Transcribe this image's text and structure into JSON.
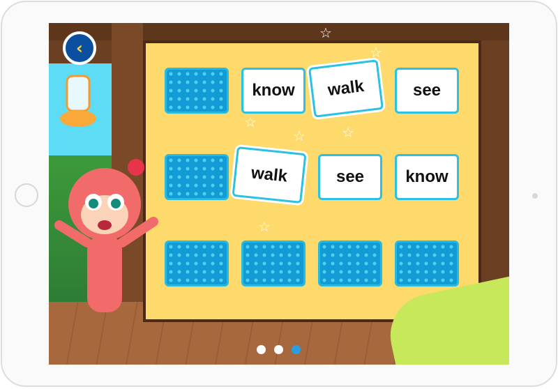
{
  "game": {
    "back_icon": "chevron-left-icon",
    "cards": [
      [
        {
          "state": "back",
          "word": ""
        },
        {
          "state": "face",
          "word": "know"
        },
        {
          "state": "face",
          "word": "walk",
          "highlight": true
        },
        {
          "state": "face",
          "word": "see"
        }
      ],
      [
        {
          "state": "back",
          "word": ""
        },
        {
          "state": "face",
          "word": "walk",
          "highlight": true
        },
        {
          "state": "face",
          "word": "see"
        },
        {
          "state": "face",
          "word": "know"
        }
      ],
      [
        {
          "state": "back",
          "word": ""
        },
        {
          "state": "back",
          "word": ""
        },
        {
          "state": "back",
          "word": ""
        },
        {
          "state": "back",
          "word": ""
        }
      ]
    ],
    "page_dots": {
      "count": 3,
      "active": 3
    },
    "colors": {
      "board": "#fed96b",
      "card_back": "#129bd4",
      "card_border": "#27b9e0",
      "back_button": "#0a4fa0",
      "active_dot": "#2a9ee0"
    }
  }
}
